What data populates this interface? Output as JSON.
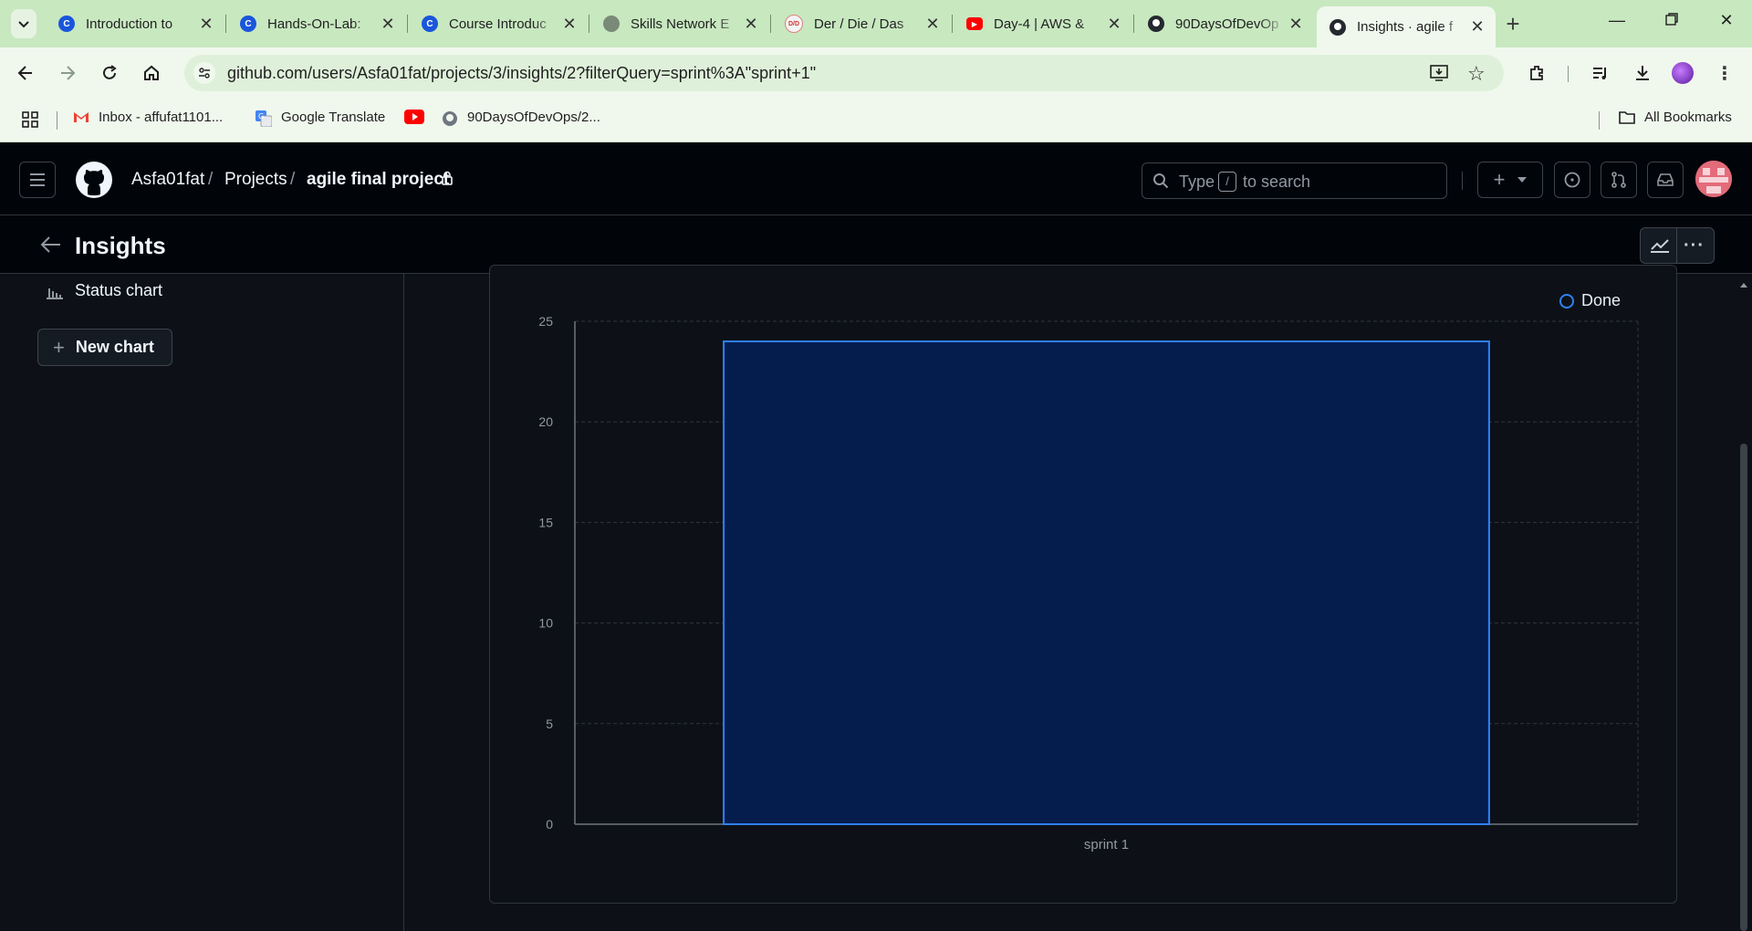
{
  "browser": {
    "tabs": [
      {
        "title": "Introduction to",
        "favicon": "coursera-icon",
        "color": "#1a56db"
      },
      {
        "title": "Hands-On-Lab:",
        "favicon": "coursera-icon",
        "color": "#1a56db"
      },
      {
        "title": "Course Introduc",
        "favicon": "coursera-icon",
        "color": "#1a56db"
      },
      {
        "title": "Skills Network E",
        "favicon": "globe-icon",
        "color": "#7a8a78"
      },
      {
        "title": "Der / Die / Das",
        "favicon": "der-die-das-icon",
        "color": "#f4f4f4"
      },
      {
        "title": "Day-4 | AWS &",
        "favicon": "youtube-icon",
        "color": "#ff0000"
      },
      {
        "title": "90DaysOfDevOp",
        "favicon": "github-icon",
        "color": "#24292f"
      },
      {
        "title": "Insights · agile f",
        "favicon": "github-icon",
        "color": "#24292f",
        "active": true
      }
    ],
    "url": "github.com/users/Asfa01fat/projects/3/insights/2?filterQuery=sprint%3A\"sprint+1\"",
    "bookmarks": [
      {
        "label": "Inbox - affufat1101...",
        "icon": "gmail-icon"
      },
      {
        "label": "Google Translate",
        "icon": "google-translate-icon"
      },
      {
        "label": "",
        "icon": "youtube-icon"
      },
      {
        "label": "90DaysOfDevOps/2...",
        "icon": "github-icon"
      }
    ],
    "all_bookmarks": "All Bookmarks"
  },
  "header": {
    "owner": "Asfa01fat",
    "separator": "/",
    "projects": "Projects",
    "project": "agile final project",
    "search_placeholder_pre": "Type",
    "search_key": "/",
    "search_placeholder_post": "to search"
  },
  "insights": {
    "title": "Insights"
  },
  "sidebar": {
    "status_chart": "Status chart",
    "new_chart": "New chart"
  },
  "chart_data": {
    "type": "bar",
    "categories": [
      "sprint 1"
    ],
    "series": [
      {
        "name": "Done",
        "values": [
          24
        ],
        "color": "#2f81f7"
      }
    ],
    "ylim": [
      0,
      25
    ],
    "yticks": [
      0,
      5,
      10,
      15,
      20,
      25
    ],
    "grid": true,
    "legend": "top-right",
    "bar_fill": "#051d4d"
  }
}
